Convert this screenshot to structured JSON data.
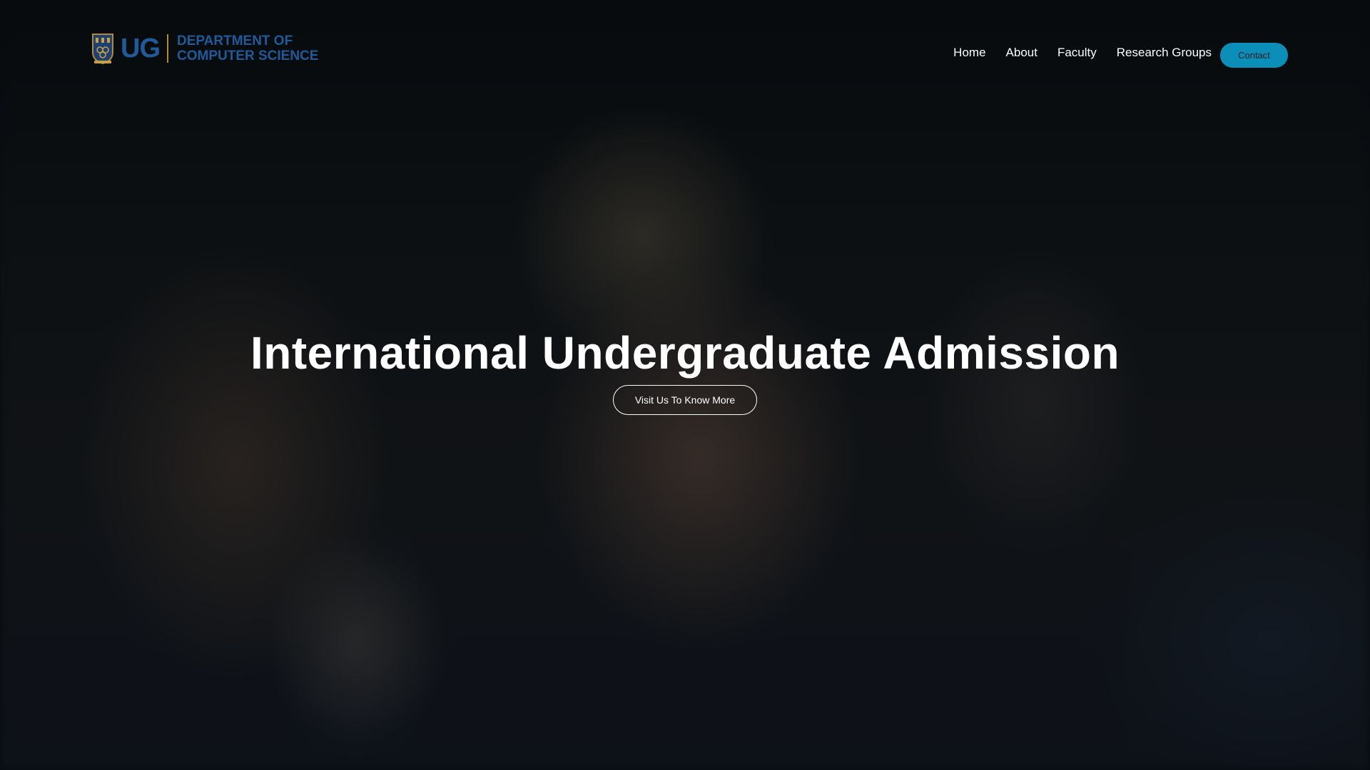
{
  "header": {
    "logo": {
      "abbr": "UG",
      "line1": "DEPARTMENT OF",
      "line2": "COMPUTER SCIENCE"
    },
    "nav": {
      "items": [
        {
          "label": "Home"
        },
        {
          "label": "About"
        },
        {
          "label": "Faculty"
        },
        {
          "label": "Research Groups"
        }
      ],
      "contact_label": "Contact"
    }
  },
  "hero": {
    "title": "International Undergraduate Admission",
    "button_label": "Visit Us To Know More"
  },
  "colors": {
    "brand_blue": "#1f5a9a",
    "accent_teal": "#0b8fb8",
    "logo_gold": "#b58a2a"
  }
}
